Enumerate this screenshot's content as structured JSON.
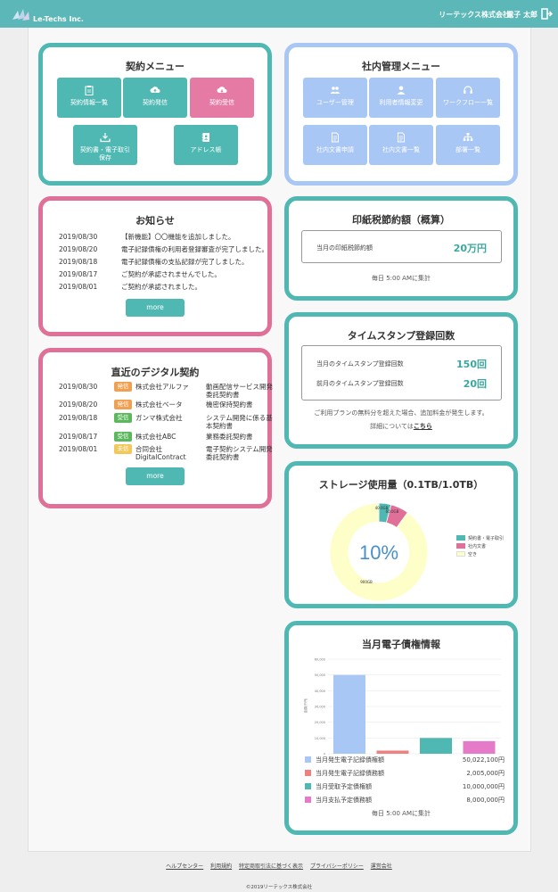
{
  "header": {
    "logo_text": "Le-Techs Inc.",
    "company": "リーテックス株式会社",
    "user": "電子 太郎"
  },
  "contract_menu": {
    "title": "契約メニュー",
    "items": [
      {
        "label": "契約情報一覧"
      },
      {
        "label": "契約発信"
      },
      {
        "label": "契約受信"
      },
      {
        "label": "契約書・電子取引保存"
      },
      {
        "label": "アドレス帳"
      }
    ]
  },
  "admin_menu": {
    "title": "社内管理メニュー",
    "items": [
      {
        "label": "ユーザー管理"
      },
      {
        "label": "利用者情報変更"
      },
      {
        "label": "ワークフロー一覧"
      },
      {
        "label": "社内文書申請"
      },
      {
        "label": "社内文書一覧"
      },
      {
        "label": "部署一覧"
      }
    ]
  },
  "news": {
    "title": "お知らせ",
    "items": [
      {
        "date": "2019/08/30",
        "text": "【新機能】〇〇機能を追加しました。"
      },
      {
        "date": "2019/08/20",
        "text": "電子記録債権の利用者登録審査が完了しました。"
      },
      {
        "date": "2019/08/18",
        "text": "電子記録債権の支払記録が完了しました。"
      },
      {
        "date": "2019/08/17",
        "text": "ご契約が承認されませんでした。"
      },
      {
        "date": "2019/08/01",
        "text": "ご契約が承認されました。"
      }
    ],
    "more_label": "more"
  },
  "digital_contracts": {
    "title": "直近のデジタル契約",
    "items": [
      {
        "date": "2019/08/30",
        "badge": "発信",
        "company": "株式会社アルファ",
        "title": "動画配信サービス開発委託契約書"
      },
      {
        "date": "2019/08/20",
        "badge": "発信",
        "company": "株式会社ベータ",
        "title": "機密保持契約書"
      },
      {
        "date": "2019/08/18",
        "badge": "受信",
        "company": "ガンマ株式会社",
        "title": "システム開発に係る基本契約書"
      },
      {
        "date": "2019/08/17",
        "badge": "受信",
        "company": "株式会社ABC",
        "title": "業務委託契約書"
      },
      {
        "date": "2019/08/01",
        "badge": "未信",
        "company": "合同会社DigitalContract",
        "title": "電子契約システム開発委託契約書"
      }
    ],
    "more_label": "more"
  },
  "stamp_tax": {
    "title": "印紙税節約額（概算）",
    "label": "当月の印紙税節約額",
    "value": "20万円",
    "note": "毎日 5:00 AMに集計"
  },
  "timestamp": {
    "title": "タイムスタンプ登録回数",
    "rows": [
      {
        "label": "当月のタイムスタンプ登録回数",
        "value": "150回"
      },
      {
        "label": "前月のタイムスタンプ登録回数",
        "value": "20回"
      }
    ],
    "note": "ご利用プランの無料分を超えた場合、追加料金が発生します。",
    "detail_prefix": "詳細については",
    "detail_link": "こちら"
  },
  "storage": {
    "title": "ストレージ使用量（0.1TB/1.0TB）",
    "percent_label": "10%",
    "colors": {
      "contract": "#50b8b2",
      "internal": "#e07098",
      "free": "#fefec8"
    },
    "chart_data": {
      "type": "pie",
      "categories": [
        "契約書・電子取引",
        "社内文書",
        "空き"
      ],
      "values": [
        40,
        60,
        900
      ],
      "data_labels": [
        "40.0GB",
        "60.0GB",
        "900GB"
      ]
    }
  },
  "e_debt": {
    "title": "当月電子債権情報",
    "ylabel": "金額(千円)",
    "chart_data": {
      "type": "bar",
      "categories": [
        "当月発生電子記録債権額",
        "当月発生電子記録債務額",
        "当月受取予定債権額",
        "当月支払予定債務額"
      ],
      "values": [
        50022,
        2005,
        10000,
        8000
      ],
      "ylim": [
        0,
        60000
      ],
      "yticks": [
        "60,000",
        "50,000",
        "40,000",
        "30,000",
        "20,000",
        "10,000",
        "0"
      ],
      "colors": [
        "#a9c7f5",
        "#ef8080",
        "#50b8b2",
        "#e57ac8"
      ]
    },
    "rows": [
      {
        "label": "当月発生電子記録債権額",
        "value": "50,022,100円"
      },
      {
        "label": "当月発生電子記録債務額",
        "value": "2,005,000円"
      },
      {
        "label": "当月受取予定債権額",
        "value": "10,000,000円"
      },
      {
        "label": "当月支払予定債務額",
        "value": "8,000,000円"
      }
    ],
    "note": "毎日 5:00 AMに集計"
  },
  "footer": {
    "links": [
      "ヘルプセンター",
      "利用規約",
      "特定商取引法に基づく表示",
      "プライバシーポリシー",
      "運営会社"
    ],
    "copyright": "©2019リーテックス株式会社"
  }
}
